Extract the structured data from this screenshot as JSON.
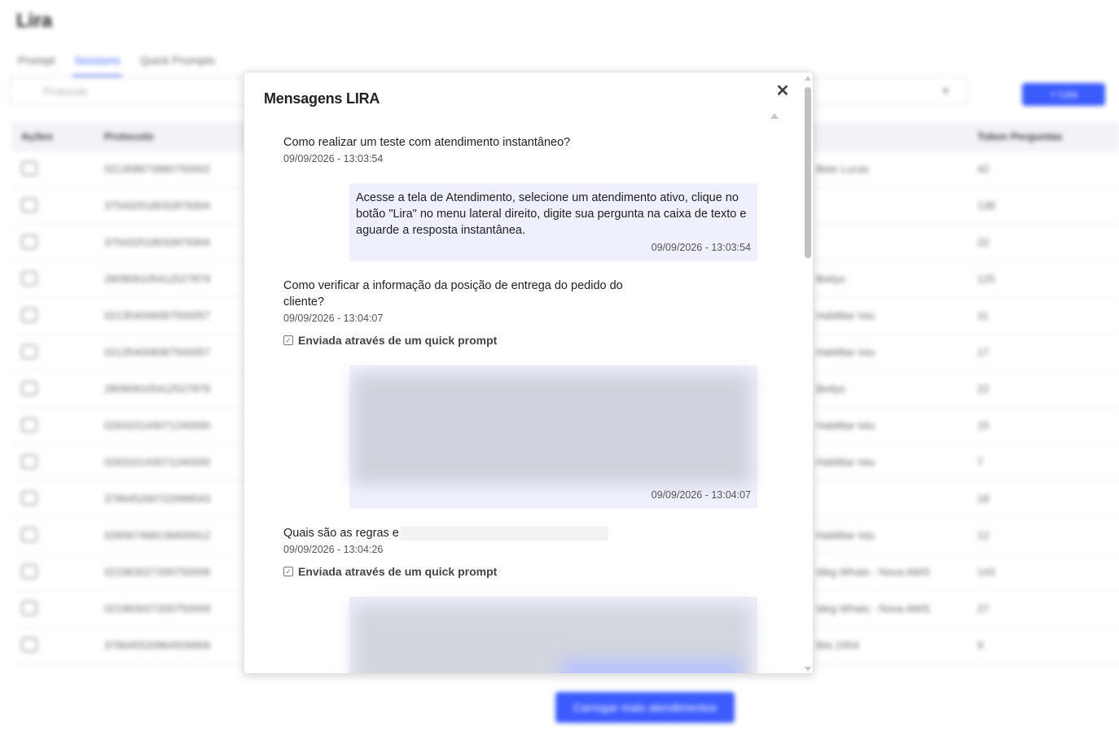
{
  "background": {
    "title": "Lira",
    "tabs": [
      "Prompt",
      "Sessions",
      "Quick Prompts"
    ],
    "search_placeholder": "Protocolo",
    "new_button": "+ Lira",
    "columns": [
      "Ações",
      "Protocolo",
      "Token Perguntas"
    ],
    "rows": [
      {
        "protocol": "021358673960750002",
        "name": "Bete Lucas",
        "tokens": "42"
      },
      {
        "protocol": "375432518032879304",
        "name": "",
        "tokens": "138"
      },
      {
        "protocol": "375432518032879304",
        "name": "",
        "tokens": "22"
      },
      {
        "protocol": "280909105412527879",
        "name": "Bettys",
        "tokens": "125"
      },
      {
        "protocol": "021354006087500057",
        "name": "Habilitar Istu",
        "tokens": "11"
      },
      {
        "protocol": "021354006087500057",
        "name": "Habilitar Istu",
        "tokens": "17"
      },
      {
        "protocol": "280909105412527879",
        "name": "Bettys",
        "tokens": "22"
      },
      {
        "protocol": "026310143071240000",
        "name": "Habilitar Istu",
        "tokens": "15"
      },
      {
        "protocol": "026310143071240000",
        "name": "Habilitar Istu",
        "tokens": "7"
      },
      {
        "protocol": "378645260722999543",
        "name": "",
        "tokens": "18"
      },
      {
        "protocol": "026567468136600912",
        "name": "Habilitar Istu",
        "tokens": "12"
      },
      {
        "protocol": "021963027200750009",
        "name": "Ideg Whats - Nova AWS",
        "tokens": "143"
      },
      {
        "protocol": "021963027200750009",
        "name": "Ideg Whats - Nova AWS",
        "tokens": "27"
      },
      {
        "protocol": "378645520864509909",
        "name": "Ibis 2454",
        "tokens": "9"
      }
    ],
    "load_more": "Carregar mais atendimentos"
  },
  "modal": {
    "title": "Mensagens LIRA",
    "close_icon": "close-icon",
    "quick_prompt_label": "Enviada através de um quick prompt",
    "messages": [
      {
        "question": "Como realizar um teste com atendimento instantâneo?",
        "question_time": "09/09/2026 - 13:03:54",
        "answer": "Acesse a tela de Atendimento, selecione um atendimento ativo, clique no botão \"Lira\" no menu lateral direito, digite sua pergunta na caixa de texto e aguarde a resposta instantânea.",
        "answer_time": "09/09/2026 - 13:03:54"
      },
      {
        "question": "Como verificar a informação da posição de entrega do pedido do cliente?",
        "question_time": "09/09/2026 - 13:04:07",
        "answer_time": "09/09/2026 - 13:04:07"
      },
      {
        "question": "Quais são as regras e",
        "question_time": "09/09/2026 - 13:04:26"
      }
    ]
  }
}
